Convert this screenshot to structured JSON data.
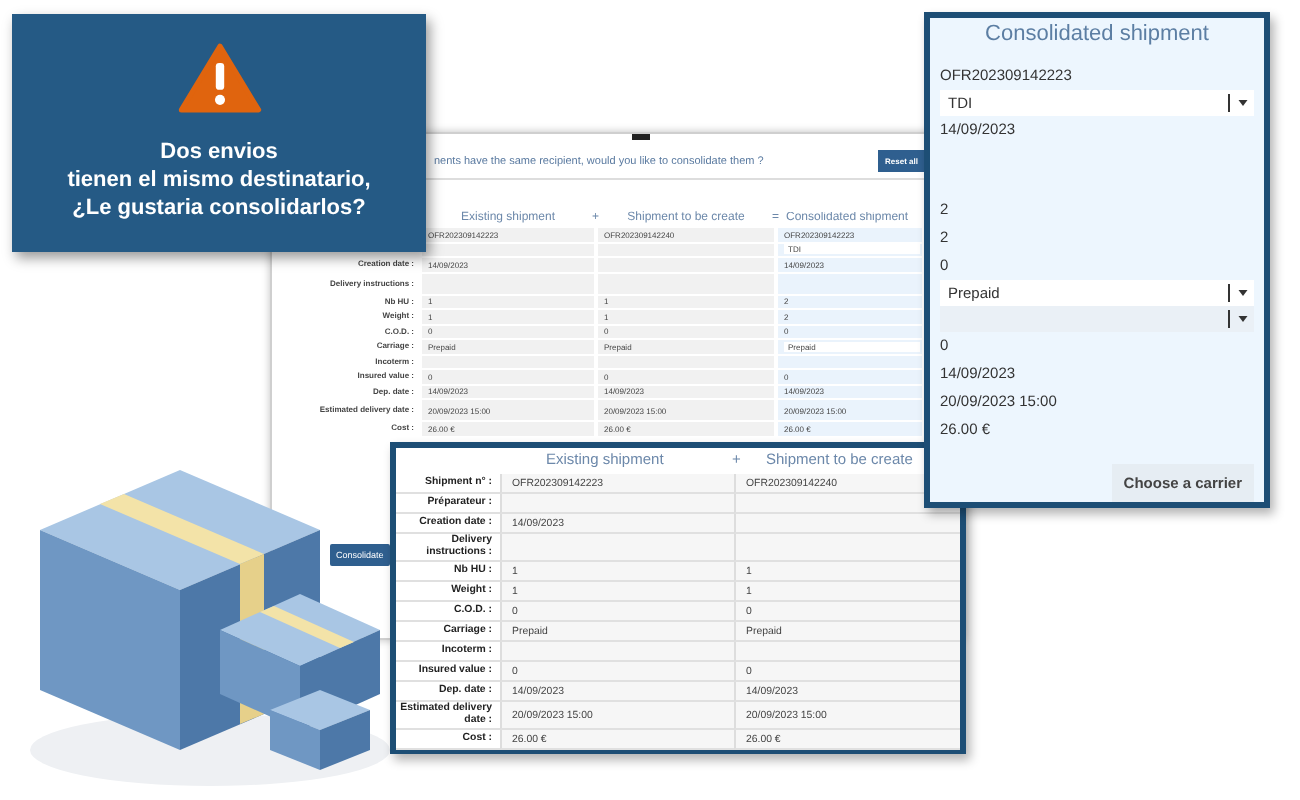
{
  "alert": {
    "lines": [
      "Dos envios",
      "tienen el mismo destinatario,",
      "¿Le gustaria consolidarlos?"
    ]
  },
  "background_window": {
    "question": "nents have the same recipient, would you like to consolidate them ?",
    "reset_button": "Reset all",
    "columns": [
      "Existing shipment",
      "Shipment to be create",
      "Consolidated shipment"
    ],
    "operators": [
      "+",
      "="
    ],
    "rows": [
      {
        "existing": "OFR202309142223",
        "to_create": "OFR202309142240",
        "consolidated": "OFR202309142223",
        "kind": "text"
      },
      {
        "consolidated": "TDI",
        "kind": "select"
      },
      {
        "label": "Creation date :",
        "existing": "14/09/2023",
        "consolidated": "14/09/2023",
        "kind": "text"
      },
      {
        "label": "Delivery instructions :",
        "kind": "tall"
      },
      {
        "label": "Nb HU :",
        "existing": "1",
        "to_create": "1",
        "consolidated": "2",
        "kind": "text"
      },
      {
        "label": "Weight :",
        "existing": "1",
        "to_create": "1",
        "consolidated": "2",
        "kind": "text"
      },
      {
        "label": "C.O.D. :",
        "existing": "0",
        "to_create": "0",
        "consolidated": "0",
        "kind": "text"
      },
      {
        "label": "Carriage :",
        "existing": "Prepaid",
        "to_create": "Prepaid",
        "consolidated": "Prepaid",
        "kind": "select"
      },
      {
        "label": "Incoterm :",
        "kind": "text"
      },
      {
        "label": "Insured value :",
        "existing": "0",
        "to_create": "0",
        "consolidated": "0",
        "kind": "text"
      },
      {
        "label": "Dep. date :",
        "existing": "14/09/2023",
        "to_create": "14/09/2023",
        "consolidated": "14/09/2023",
        "kind": "text"
      },
      {
        "label": "Estimated delivery date :",
        "existing": "20/09/2023 15:00",
        "to_create": "20/09/2023 15:00",
        "consolidated": "20/09/2023 15:00",
        "kind": "tall"
      },
      {
        "label": "Cost :",
        "existing": "26.00 €",
        "to_create": "26.00 €",
        "consolidated": "26.00 €",
        "kind": "text"
      }
    ],
    "consolidate_button": "Consolidate"
  },
  "consolidated_panel": {
    "title": "Consolidated shipment",
    "fields": [
      {
        "kind": "text",
        "value": "OFR202309142223"
      },
      {
        "kind": "select",
        "value": "TDI"
      },
      {
        "kind": "text",
        "value": "14/09/2023"
      },
      {
        "kind": "blank"
      },
      {
        "kind": "text",
        "value": "2"
      },
      {
        "kind": "text",
        "value": "2"
      },
      {
        "kind": "text",
        "value": "0"
      },
      {
        "kind": "select",
        "value": "Prepaid"
      },
      {
        "kind": "select"
      },
      {
        "kind": "text",
        "value": "0"
      },
      {
        "kind": "text",
        "value": "14/09/2023"
      },
      {
        "kind": "text",
        "value": "20/09/2023 15:00"
      },
      {
        "kind": "text",
        "value": "26.00 €"
      }
    ],
    "button": "Choose a carrier"
  },
  "comparison_panel": {
    "columns": [
      "Existing shipment",
      "Shipment to be create"
    ],
    "operator": "+",
    "rows": [
      {
        "label": "Shipment n° :",
        "existing": "OFR202309142223",
        "to_create": "OFR202309142240",
        "kind": "text"
      },
      {
        "label": "Préparateur :",
        "kind": "text"
      },
      {
        "label": "Creation date :",
        "existing": "14/09/2023",
        "kind": "text"
      },
      {
        "label": "Delivery instructions :",
        "kind": "tall"
      },
      {
        "label": "Nb HU :",
        "existing": "1",
        "to_create": "1",
        "kind": "text"
      },
      {
        "label": "Weight :",
        "existing": "1",
        "to_create": "1",
        "kind": "text"
      },
      {
        "label": "C.O.D. :",
        "existing": "0",
        "to_create": "0",
        "kind": "text"
      },
      {
        "label": "Carriage :",
        "existing": "Prepaid",
        "to_create": "Prepaid",
        "kind": "text"
      },
      {
        "label": "Incoterm :",
        "kind": "text"
      },
      {
        "label": "Insured value :",
        "existing": "0",
        "to_create": "0",
        "kind": "text"
      },
      {
        "label": "Dep. date :",
        "existing": "14/09/2023",
        "to_create": "14/09/2023",
        "kind": "text"
      },
      {
        "label": "Estimated delivery date :",
        "existing": "20/09/2023 15:00",
        "to_create": "20/09/2023 15:00",
        "kind": "tall"
      },
      {
        "label": "Cost :",
        "existing": "26.00 €",
        "to_create": "26.00 €",
        "kind": "text"
      }
    ]
  }
}
